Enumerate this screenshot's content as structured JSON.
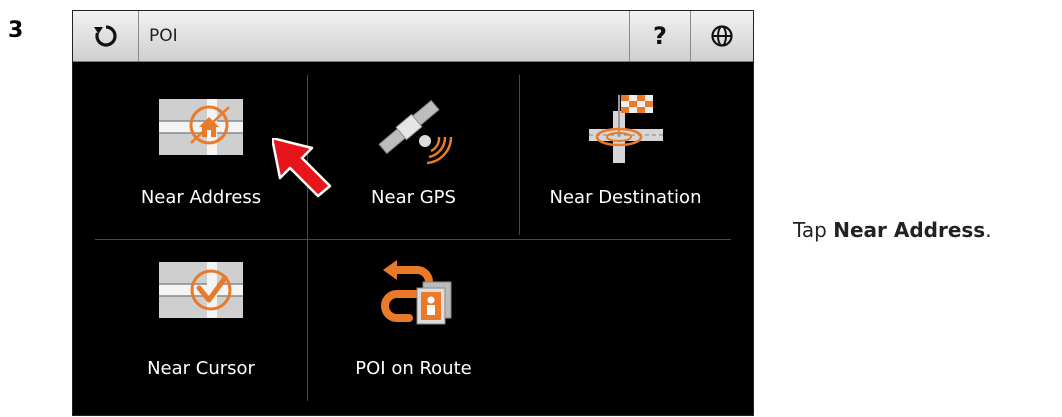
{
  "step": {
    "number": "3"
  },
  "titlebar": {
    "title": "POI",
    "help_label": "?",
    "back_icon": "refresh-back-icon",
    "language_icon": "globe-icon"
  },
  "menu": {
    "items": [
      {
        "label": "Near Address",
        "icon": "near-address-icon"
      },
      {
        "label": "Near GPS",
        "icon": "satellite-icon"
      },
      {
        "label": "Near Destination",
        "icon": "destination-flag-icon"
      },
      {
        "label": "Near Cursor",
        "icon": "near-cursor-icon"
      },
      {
        "label": "POI on Route",
        "icon": "poi-on-route-icon"
      }
    ]
  },
  "instruction": {
    "prefix": "Tap ",
    "emphasis": "Near Address",
    "suffix": "."
  },
  "colors": {
    "accent": "#e87a2a",
    "pointer": "#e8141b",
    "screen_bg": "#000000"
  }
}
